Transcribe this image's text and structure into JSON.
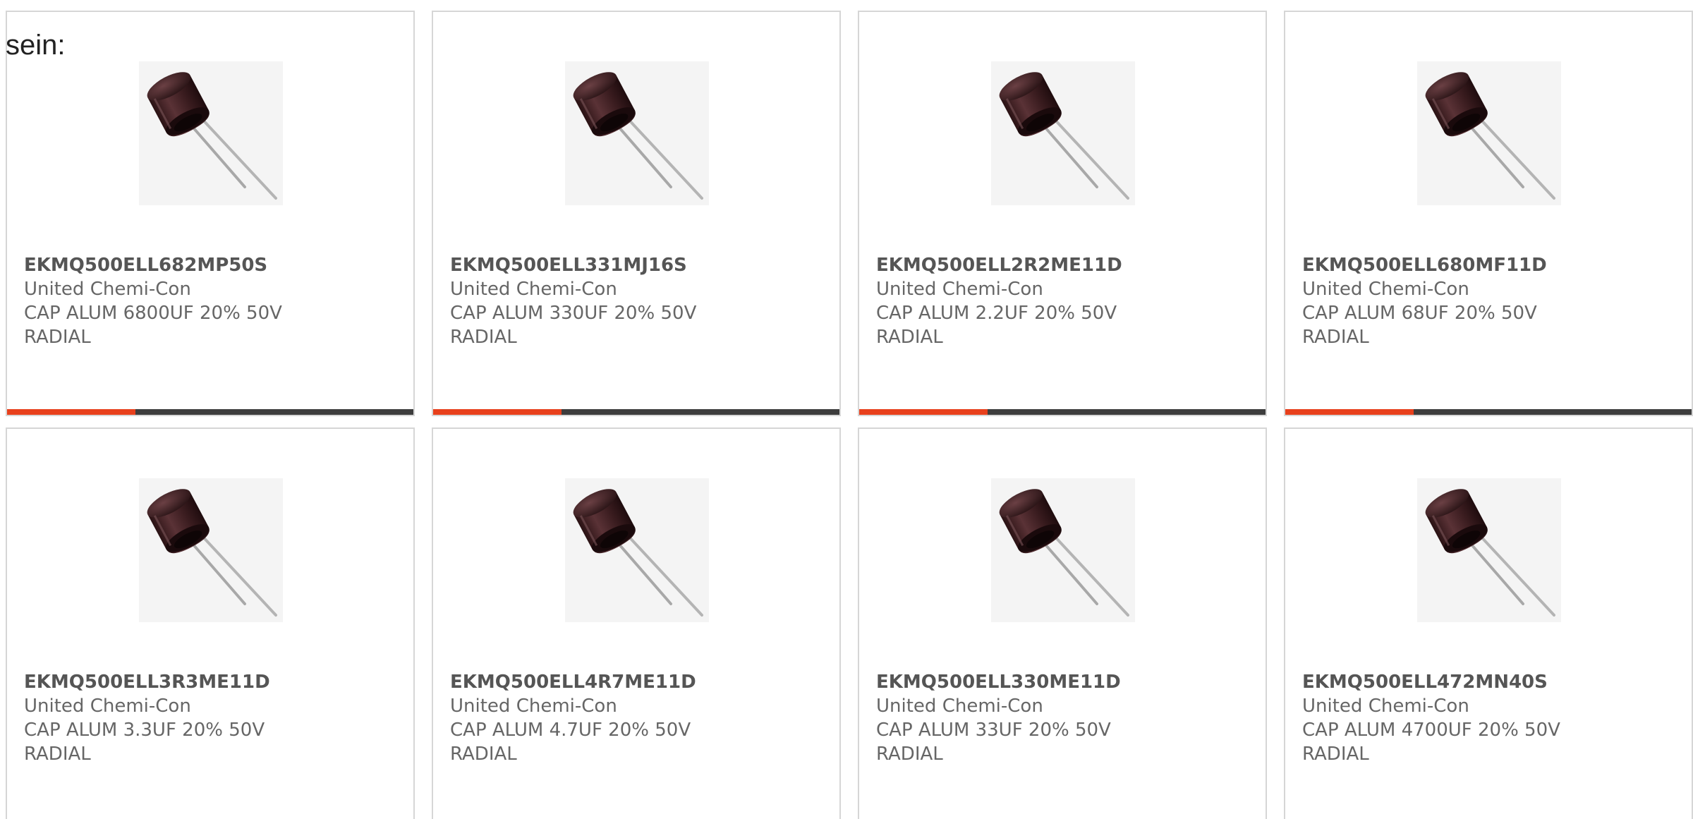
{
  "intro_text": "sein:",
  "products": [
    {
      "part_number": "EKMQ500ELL682MP50S",
      "manufacturer": "United Chemi-Con",
      "description": "CAP ALUM 6800UF 20% 50V",
      "package": "RADIAL",
      "image_icon": "radial-capacitor-image"
    },
    {
      "part_number": "EKMQ500ELL331MJ16S",
      "manufacturer": "United Chemi-Con",
      "description": "CAP ALUM 330UF 20% 50V",
      "package": "RADIAL",
      "image_icon": "radial-capacitor-image"
    },
    {
      "part_number": "EKMQ500ELL2R2ME11D",
      "manufacturer": "United Chemi-Con",
      "description": "CAP ALUM 2.2UF 20% 50V",
      "package": "RADIAL",
      "image_icon": "radial-capacitor-image"
    },
    {
      "part_number": "EKMQ500ELL680MF11D",
      "manufacturer": "United Chemi-Con",
      "description": "CAP ALUM 68UF 20% 50V",
      "package": "RADIAL",
      "image_icon": "radial-capacitor-image"
    },
    {
      "part_number": "EKMQ500ELL3R3ME11D",
      "manufacturer": "United Chemi-Con",
      "description": "CAP ALUM 3.3UF 20% 50V",
      "package": "RADIAL",
      "image_icon": "radial-capacitor-image"
    },
    {
      "part_number": "EKMQ500ELL4R7ME11D",
      "manufacturer": "United Chemi-Con",
      "description": "CAP ALUM 4.7UF 20% 50V",
      "package": "RADIAL",
      "image_icon": "radial-capacitor-image"
    },
    {
      "part_number": "EKMQ500ELL330ME11D",
      "manufacturer": "United Chemi-Con",
      "description": "CAP ALUM 33UF 20% 50V",
      "package": "RADIAL",
      "image_icon": "radial-capacitor-image"
    },
    {
      "part_number": "EKMQ500ELL472MN40S",
      "manufacturer": "United Chemi-Con",
      "description": "CAP ALUM 4700UF 20% 50V",
      "package": "RADIAL",
      "image_icon": "radial-capacitor-image"
    }
  ],
  "colors": {
    "accent": "#e8401c",
    "bar": "#3d3d3d",
    "border": "#d6d6d6",
    "text": "#666666"
  }
}
